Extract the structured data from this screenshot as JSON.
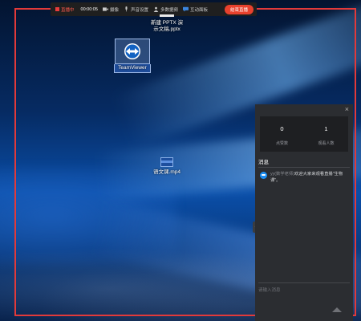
{
  "toolbar": {
    "status": "直播中",
    "time": "00:00:05",
    "camera_label": "摄像",
    "mic_label": "声音设置",
    "multi_label": "多数据频",
    "interact_label": "互动面板",
    "end_label": "结束直播"
  },
  "desktop": {
    "icons": [
      {
        "name": "新建 PPTX 演示文稿.pptx",
        "line1": "新建 PPTX 演",
        "line2": "示文稿.pptx"
      },
      {
        "name": "TeamViewer",
        "label": "TeamViewer"
      },
      {
        "name": "语文课.mp4",
        "label": "语文课.mp4"
      }
    ]
  },
  "panel": {
    "close": "×",
    "stats": [
      {
        "value": "0",
        "label": "点赞数"
      },
      {
        "value": "1",
        "label": "观看人数"
      }
    ],
    "messages_title": "消息",
    "messages": [
      {
        "sender": "yy(数学老师)",
        "text": "欢迎大家来观看直播\"生物课\"。"
      }
    ],
    "input_placeholder": "请输入消息",
    "collapse": "‹"
  },
  "colors": {
    "record_border": "#e23a3a",
    "end_button": "#e8412d",
    "panel_bg": "#2b2d31",
    "avatar": "#1b8df0"
  }
}
